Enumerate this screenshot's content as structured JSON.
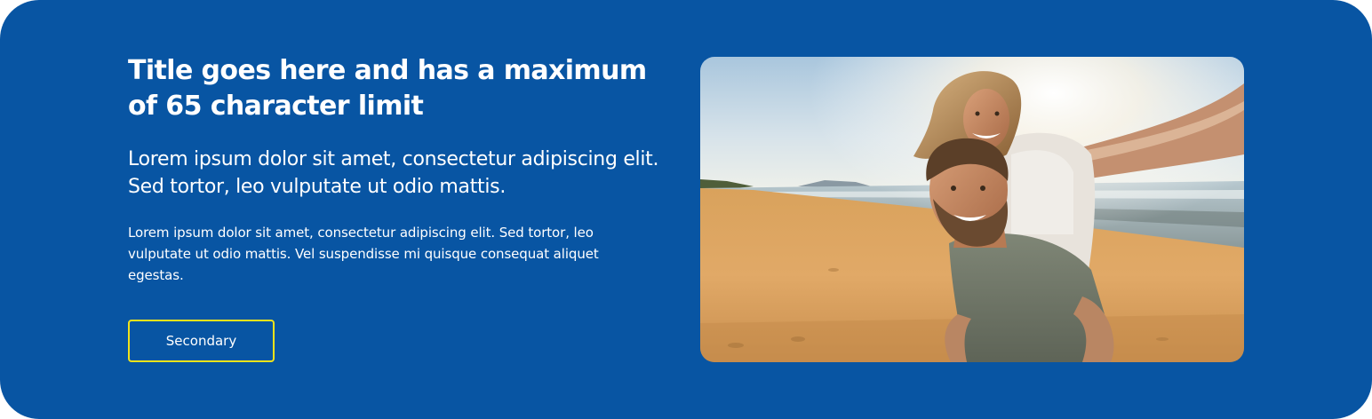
{
  "banner": {
    "title": "Title goes here and has a maximum of 65 character limit",
    "lead": "Lorem ipsum dolor sit amet, consectetur adipiscing elit. Sed tortor, leo vulputate ut odio mattis.",
    "body": "Lorem ipsum dolor sit amet, consectetur adipiscing elit. Sed tortor, leo vulputate ut odio mattis. Vel suspendisse mi quisque consequat aliquet egestas.",
    "cta_label": "Secondary"
  },
  "colors": {
    "background": "#0855a3",
    "text": "#ffffff",
    "button_border": "#f2e31a"
  },
  "image": {
    "subject": "couple-on-beach-selfie"
  }
}
